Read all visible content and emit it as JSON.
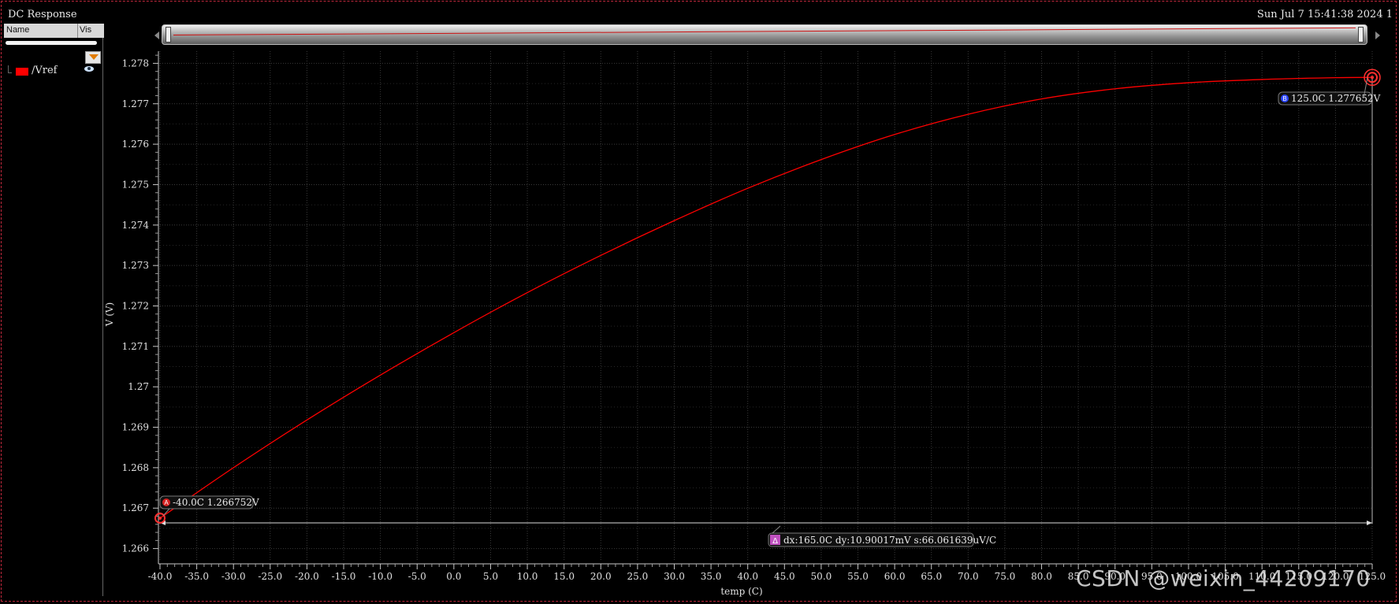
{
  "window": {
    "title": "DC Response",
    "datetime": "Sun Jul 7 15:41:38 2024  1"
  },
  "legend_panel": {
    "col_name": "Name",
    "col_vis": "Vis",
    "signals": [
      {
        "name": "/Vref",
        "color": "#ff0000"
      }
    ]
  },
  "markers": {
    "A": {
      "letter": "A",
      "label": "-40.0C 1.266752V",
      "x": -40.0,
      "y": 1.266752
    },
    "B": {
      "letter": "B",
      "label": "125.0C 1.277652V",
      "x": 125.0,
      "y": 1.277652
    },
    "delta": {
      "label": "dx:165.0C dy:10.90017mV s:66.061639uV/C"
    }
  },
  "watermark": "CSDN @weixin_44209170",
  "chart_data": {
    "type": "line",
    "xlabel": "temp (C)",
    "ylabel": "V (V)",
    "xlim": [
      -40.0,
      125.0
    ],
    "ylim": [
      1.2657,
      1.2783
    ],
    "xticks": [
      -40,
      -35,
      -30,
      -25,
      -20,
      -15,
      -10,
      -5,
      0,
      5,
      10,
      15,
      20,
      25,
      30,
      35,
      40,
      45,
      50,
      55,
      60,
      65,
      70,
      75,
      80,
      85,
      90,
      95,
      100,
      105,
      110,
      115,
      120,
      125
    ],
    "xtick_labels": [
      "-40.0",
      "-35.0",
      "-30.0",
      "-25.0",
      "-20.0",
      "-15.0",
      "-10.0",
      "-5.0",
      "0.0",
      "5.0",
      "10.0",
      "15.0",
      "20.0",
      "25.0",
      "30.0",
      "35.0",
      "40.0",
      "45.0",
      "50.0",
      "55.0",
      "60.0",
      "65.0",
      "70.0",
      "75.0",
      "80.0",
      "85.0",
      "90.0",
      "95.0",
      "100.0",
      "105.0",
      "110.0",
      "115.0",
      "120.0",
      "125.0"
    ],
    "yticks": [
      1.266,
      1.267,
      1.268,
      1.269,
      1.27,
      1.271,
      1.272,
      1.273,
      1.274,
      1.275,
      1.276,
      1.277,
      1.278
    ],
    "ytick_labels": [
      "1.266",
      "1.267",
      "1.268",
      "1.269",
      "1.27",
      "1.271",
      "1.272",
      "1.273",
      "1.274",
      "1.275",
      "1.276",
      "1.277",
      "1.278"
    ],
    "grid": true,
    "series": [
      {
        "name": "/Vref",
        "color": "#ff0000",
        "x": [
          -40,
          -30,
          -20,
          -10,
          0,
          10,
          20,
          30,
          40,
          50,
          60,
          70,
          80,
          90,
          100,
          110,
          120,
          125
        ],
        "y": [
          1.266752,
          1.268,
          1.26918,
          1.27029,
          1.27134,
          1.27233,
          1.27325,
          1.27411,
          1.27491,
          1.27562,
          1.27624,
          1.27674,
          1.27712,
          1.27737,
          1.27752,
          1.2776,
          1.277645,
          1.277652
        ]
      }
    ]
  }
}
